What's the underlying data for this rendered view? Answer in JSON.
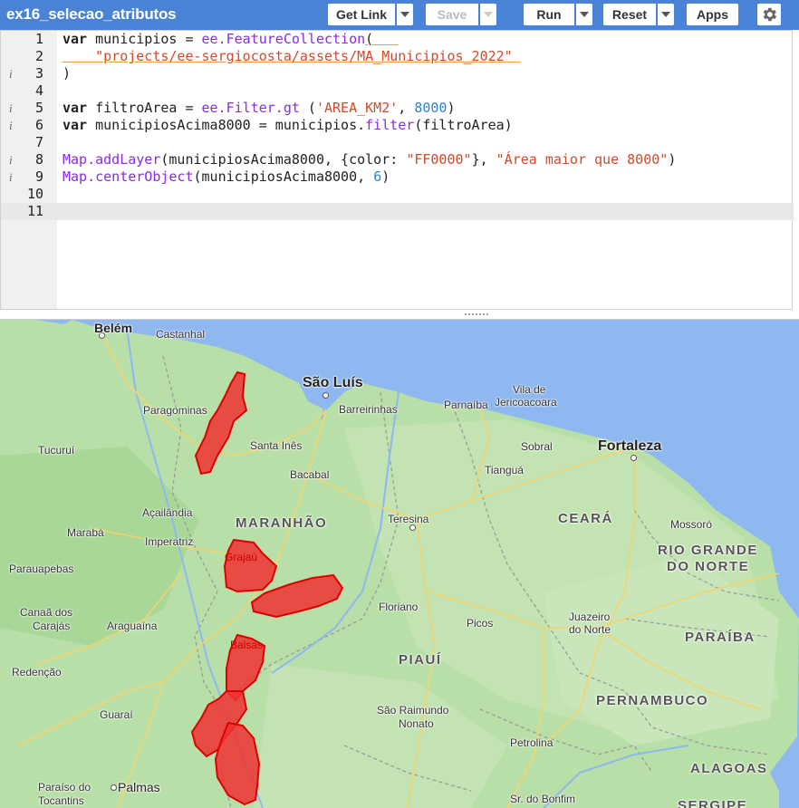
{
  "toolbar": {
    "script_title": "ex16_selecao_atributos",
    "get_link": "Get Link",
    "save": "Save",
    "run": "Run",
    "reset": "Reset",
    "apps": "Apps"
  },
  "editor": {
    "line_numbers": [
      "1",
      "2",
      "3",
      "4",
      "5",
      "6",
      "7",
      "8",
      "9",
      "10",
      "11"
    ],
    "active_line": "11"
  },
  "map": {
    "state_labels": {
      "maranhao": "MARANHÃO",
      "ceara": "CEARÁ",
      "rio_grande_do_norte_1": "RIO GRANDE",
      "rio_grande_do_norte_2": "DO NORTE",
      "piaui": "PIAUÍ",
      "paraiba": "PARAÍBA",
      "pernambuco": "PERNAMBUCO",
      "alagoas": "ALAGOAS",
      "sergipe": "SERGIPE"
    },
    "cities": {
      "belem": "Belém",
      "castanhal": "Castanhal",
      "sao_luis": "São Luís",
      "barreirinhas": "Barreirinhas",
      "parnaiba": "Parnaíba",
      "vila_de": "Vila de",
      "jericoacoara": "Jericoacoara",
      "paragominas": "Paragominas",
      "tucurui": "Tucuruí",
      "santa_ines": "Santa Inês",
      "sobral": "Sobral",
      "fortaleza": "Fortaleza",
      "tiangua": "Tianguá",
      "bacabal": "Bacabal",
      "acailandia": "Açailândia",
      "teresina": "Teresina",
      "maraba": "Marabá",
      "imperatriz": "Imperatriz",
      "mossoro": "Mossoró",
      "parauapebas": "Parauapebas",
      "grajau": "Grajaú",
      "floriano": "Floriano",
      "canaa_1": "Canaã dos",
      "canaa_2": "Carajás",
      "araguaina": "Araguaína",
      "picos": "Picos",
      "juazeiro_1": "Juazeiro",
      "juazeiro_2": "do Norte",
      "balsas": "Balsas",
      "redencao": "Redenção",
      "sao_raimundo_1": "São Raimundo",
      "sao_raimundo_2": "Nonato",
      "guarai": "Guaraí",
      "petrolina": "Petrolina",
      "paraiso_1": "Paraíso do",
      "paraiso_2": "Tocantins",
      "palmas": "Palmas",
      "sr_do_bonfim": "Sr. do Bonfim"
    },
    "layer_color": "#FF0000"
  }
}
